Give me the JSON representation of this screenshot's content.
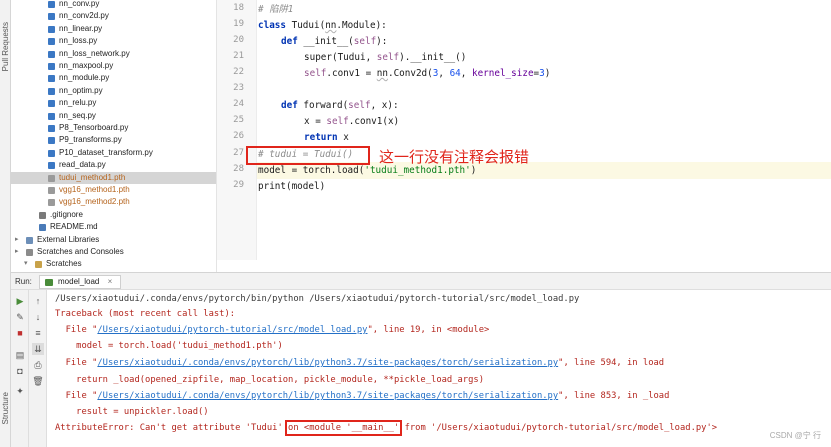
{
  "sidebar": {
    "pull_requests": "Pull Requests",
    "structure": "Structure"
  },
  "project_tree": [
    {
      "label": "nn_conv.py",
      "type": "py"
    },
    {
      "label": "nn_conv2d.py",
      "type": "py"
    },
    {
      "label": "nn_linear.py",
      "type": "py"
    },
    {
      "label": "nn_loss.py",
      "type": "py"
    },
    {
      "label": "nn_loss_network.py",
      "type": "py"
    },
    {
      "label": "nn_maxpool.py",
      "type": "py"
    },
    {
      "label": "nn_module.py",
      "type": "py"
    },
    {
      "label": "nn_optim.py",
      "type": "py"
    },
    {
      "label": "nn_relu.py",
      "type": "py"
    },
    {
      "label": "nn_seq.py",
      "type": "py"
    },
    {
      "label": "P8_Tensorboard.py",
      "type": "py"
    },
    {
      "label": "P9_transforms.py",
      "type": "py"
    },
    {
      "label": "P10_dataset_transform.py",
      "type": "py"
    },
    {
      "label": "read_data.py",
      "type": "py"
    },
    {
      "label": "tudui_method1.pth",
      "type": "pth",
      "selected": true
    },
    {
      "label": "vgg16_method1.pth",
      "type": "pth"
    },
    {
      "label": "vgg16_method2.pth",
      "type": "pth"
    },
    {
      "label": ".gitignore",
      "type": "git"
    },
    {
      "label": "README.md",
      "type": "md"
    },
    {
      "label": "External Libraries",
      "type": "lib"
    },
    {
      "label": "Scratches and Consoles",
      "type": "scratch"
    },
    {
      "label": "Scratches",
      "type": "folder"
    }
  ],
  "editor": {
    "line_numbers": [
      "18",
      "19",
      "20",
      "21",
      "22",
      "23",
      "24",
      "25",
      "26",
      "27",
      "28",
      "29"
    ],
    "code": {
      "l18": "# 陷阱1",
      "l19_kw": "class",
      "l19_a": " Tudui(",
      "l19_b": "nn",
      "l19_c": ".Module):",
      "l20_kw": "def",
      "l20_fn": " __init__(",
      "l20_self": "self",
      "l20_end": "):",
      "l21_a": "super(Tudui, ",
      "l21_self": "self",
      "l21_b": ").__init__()",
      "l22_self": "self",
      "l22_a": ".conv1 = ",
      "l22_nn": "nn",
      "l22_b": ".Conv2d(",
      "l22_n1": "3",
      "l22_c": ", ",
      "l22_n2": "64",
      "l22_d": ", ",
      "l22_p": "kernel_size",
      "l22_e": "=",
      "l22_n3": "3",
      "l22_f": ")",
      "l24_kw": "def",
      "l24_a": " forward(",
      "l24_self": "self",
      "l24_b": ", x):",
      "l25_a": "x = ",
      "l25_self": "self",
      "l25_b": ".conv1(x)",
      "l26_kw": "return",
      "l26_a": " x",
      "l27": "# tudui = Tudui()",
      "l28_a": "model = torch.load(",
      "l28_str": "'tudui_method1.pth'",
      "l28_b": ")",
      "l29": "print(model)"
    },
    "annotation": "这一行没有注释会报错"
  },
  "run": {
    "label": "Run:",
    "tab": "model_load"
  },
  "console": {
    "cmd": "/Users/xiaotudui/.conda/envs/pytorch/bin/python /Users/xiaotudui/pytorch-tutorial/src/model_load.py",
    "traceback": "Traceback (most recent call last):",
    "f1_pre": "  File \"",
    "f1_link": "/Users/xiaotudui/pytorch-tutorial/src/model_load.py",
    "f1_post": "\", line 19, in <module>",
    "f1_code": "    model = torch.load('tudui_method1.pth')",
    "f2_pre": "  File \"",
    "f2_link": "/Users/xiaotudui/.conda/envs/pytorch/lib/python3.7/site-packages/torch/serialization.py",
    "f2_post": "\", line 594, in load",
    "f2_code": "    return _load(opened_zipfile, map_location, pickle_module, **pickle_load_args)",
    "f3_pre": "  File \"",
    "f3_link": "/Users/xiaotudui/.conda/envs/pytorch/lib/python3.7/site-packages/torch/serialization.py",
    "f3_post": "\", line 853, in _load",
    "f3_code": "    result = unpickler.load()",
    "err_a": "AttributeError: Can't get attribute 'Tudui' ",
    "err_box": "on <module '__main__'",
    "err_b": " from '/Users/xiaotudui/pytorch-tutorial/src/model_load.py'>"
  },
  "watermark": "CSDN @宁 行",
  "colors": {
    "annotation_red": "#e0251b",
    "link_blue": "#2470c7",
    "error_red": "#b3261e"
  }
}
